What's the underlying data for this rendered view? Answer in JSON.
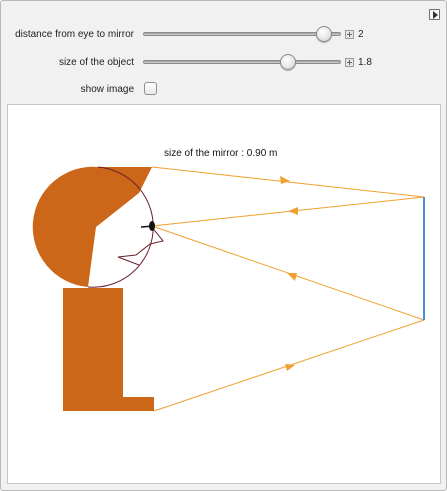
{
  "controls": {
    "distance": {
      "label": "distance from eye to mirror",
      "value_text": "2",
      "value": 2,
      "fraction": 0.95
    },
    "object_size": {
      "label": "size of the object",
      "value_text": "1.8",
      "value": 1.8,
      "fraction": 0.75
    },
    "show_image": {
      "label": "show image",
      "checked": false
    }
  },
  "scene": {
    "mirror_size_text": "size of the mirror : 0.90 m",
    "colors": {
      "object_fill": "#cc6619",
      "ray": "#f0a030",
      "mirror": "#4a90d0",
      "face_outline": "#6b1f2b",
      "eye": "#111111"
    }
  },
  "icons": {
    "corner_button": "play-triangle-icon"
  }
}
